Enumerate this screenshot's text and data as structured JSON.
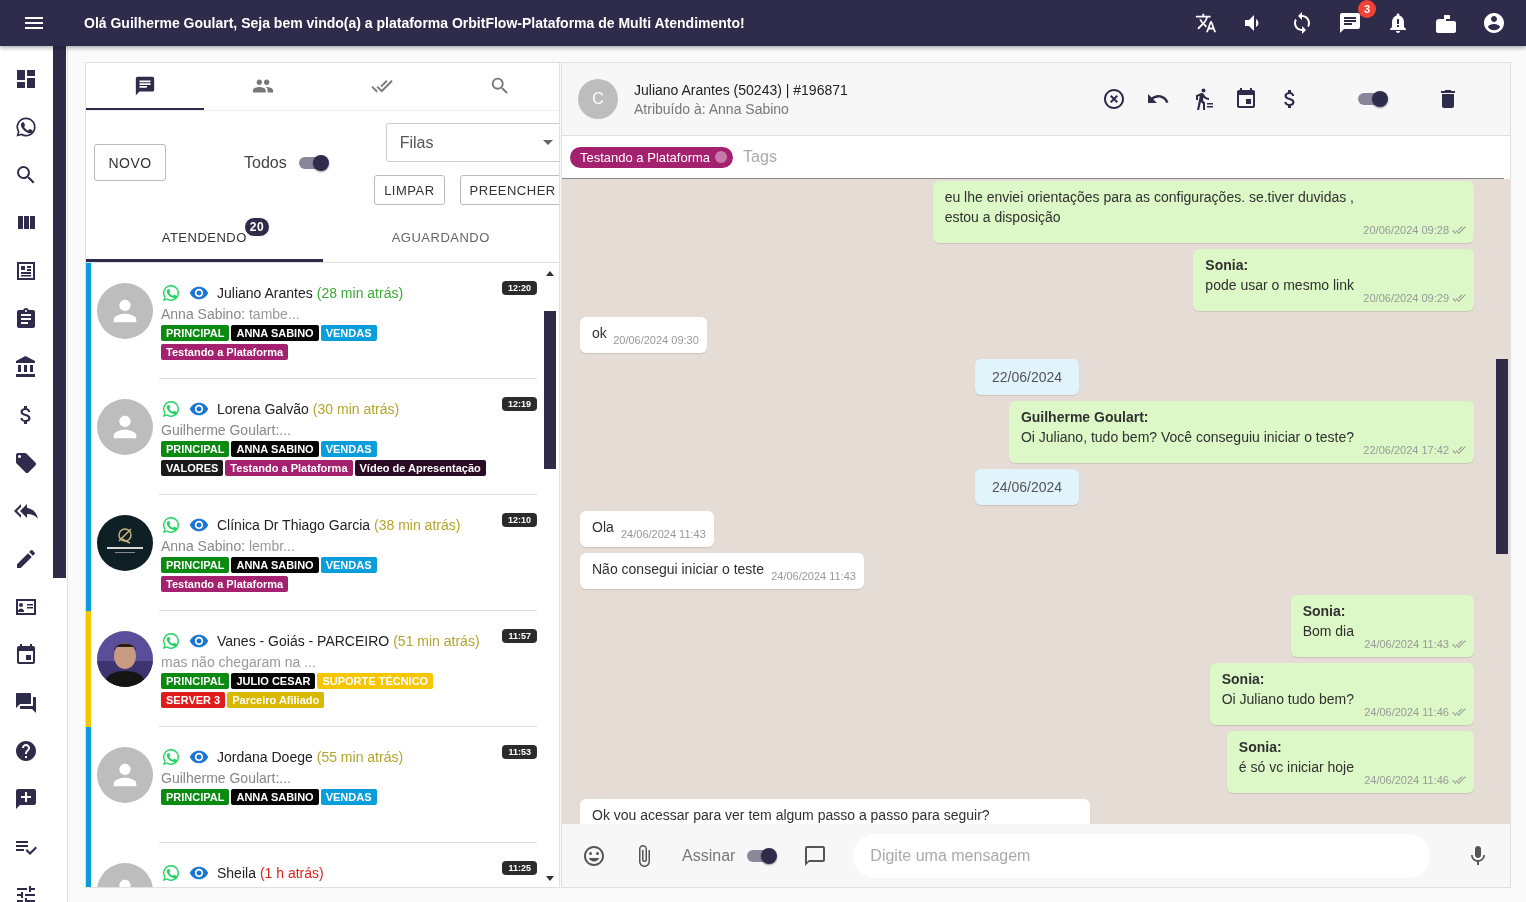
{
  "top_bar": {
    "title": "Olá Guilherme Goulart, Seja bem vindo(a) a plataforma OrbitFlow-Plataforma de Multi Atendimento!",
    "chat_badge": "3"
  },
  "ticket_panel": {
    "tabs": [
      {
        "selected": true
      },
      {
        "selected": false
      },
      {
        "selected": false
      },
      {
        "selected": false
      }
    ],
    "new_button": "NOVO",
    "all_toggle": {
      "label": "Todos",
      "on": true
    },
    "queue_select": {
      "placeholder": "Filas"
    },
    "clear_button": "LIMPAR",
    "fill_button": "PREENCHER",
    "subtabs": [
      {
        "label": "ATENDENDO",
        "badge": "20",
        "selected": true
      },
      {
        "label": "AGUARDANDO",
        "selected": false
      }
    ],
    "tickets": [
      {
        "name": "Juliano Arantes",
        "ago": {
          "text": "(28 min atrás)",
          "color": "#3aaa35"
        },
        "color": "#0a9ddc",
        "avatar": {
          "kind": "default"
        },
        "time": "12:20",
        "preview_author": "Anna Sabino:",
        "preview": "tambe...",
        "badges": [
          {
            "label": "PRINCIPAL",
            "color": "#0b8a12"
          },
          {
            "label": "ANNA SABINO",
            "color": "#050505"
          },
          {
            "label": "VENDAS",
            "color": "#0a9ddc"
          }
        ],
        "tags": [
          {
            "label": "Testando a Plataforma",
            "color": "#a3216f"
          }
        ]
      },
      {
        "name": "Lorena Galvão",
        "ago": {
          "text": "(30 min atrás)",
          "color": "#b3a52a"
        },
        "color": "#0a9ddc",
        "avatar": {
          "kind": "default"
        },
        "time": "12:19",
        "preview_author": "Guilherme Goulart:...",
        "badges": [
          {
            "label": "PRINCIPAL",
            "color": "#0b8a12"
          },
          {
            "label": "ANNA SABINO",
            "color": "#050505"
          },
          {
            "label": "VENDAS",
            "color": "#0a9ddc"
          }
        ],
        "tags": [
          {
            "label": "VALORES",
            "color": "#1a1a1a"
          },
          {
            "label": "Testando a Plataforma",
            "color": "#a3216f"
          },
          {
            "label": "Vídeo de Apresentação",
            "color": "#2b0a24"
          }
        ]
      },
      {
        "name": "Clínica Dr Thiago Garcia",
        "ago": {
          "text": "(38 min atrás)",
          "color": "#b3a52a"
        },
        "color": "#0a9ddc",
        "avatar": {
          "kind": "logo"
        },
        "time": "12:10",
        "preview_author": "Anna Sabino:",
        "preview": "lembr...",
        "badges": [
          {
            "label": "PRINCIPAL",
            "color": "#0b8a12"
          },
          {
            "label": "ANNA SABINO",
            "color": "#050505"
          },
          {
            "label": "VENDAS",
            "color": "#0a9ddc"
          }
        ],
        "tags": [
          {
            "label": "Testando a Plataforma",
            "color": "#a3216f"
          }
        ]
      },
      {
        "name": "Vanes - Goiás - PARCEIRO",
        "ago": {
          "text": "(51 min atrás)",
          "color": "#b3a52a"
        },
        "color": "#f7c600",
        "avatar": {
          "kind": "picture"
        },
        "time": "11:57",
        "preview": "mas não chegaram na ...",
        "badges": [
          {
            "label": "PRINCIPAL",
            "color": "#0b8a12"
          },
          {
            "label": "JULIO CESAR",
            "color": "#050505"
          },
          {
            "label": "SUPORTE TÉCNICO",
            "color": "#f7c600"
          }
        ],
        "tags": [
          {
            "label": "SERVER 3",
            "color": "#e01b1b"
          },
          {
            "label": "Parceiro Afiliado",
            "color": "#d8b800"
          }
        ]
      },
      {
        "name": "Jordana Doege",
        "ago": {
          "text": "(55 min atrás)",
          "color": "#b3a52a"
        },
        "color": "#0a9ddc",
        "avatar": {
          "kind": "default"
        },
        "time": "11:53",
        "preview_author": "Guilherme Goulart:...",
        "badges": [
          {
            "label": "PRINCIPAL",
            "color": "#0b8a12"
          },
          {
            "label": "ANNA SABINO",
            "color": "#050505"
          },
          {
            "label": "VENDAS",
            "color": "#0a9ddc"
          }
        ]
      },
      {
        "name": "Sheila",
        "ago": {
          "text": "(1 h atrás)",
          "color": "#e0201c"
        },
        "color": "#0a9ddc",
        "avatar": {
          "kind": "default"
        },
        "time": "11:25"
      }
    ]
  },
  "chat": {
    "avatar_letter": "C",
    "title": "Juliano Arantes (50243) | #196871",
    "subtitle": "Atribuído à: Anna Sabino",
    "action_toggle": {
      "on": true
    },
    "tag_chips": [
      "Testando a Plataforma"
    ],
    "tags_placeholder": "Tags",
    "messages": [
      {
        "kind": "out",
        "text": "eu lhe enviei orientações para as configurações.  se.tiver duvidas ,\nestou a disposição",
        "time": "20/06/2024 09:28"
      },
      {
        "kind": "out",
        "sender": "Sonia:",
        "text": "pode usar o mesmo link",
        "time": "20/06/2024 09:29"
      },
      {
        "kind": "in",
        "text": "ok",
        "time": "20/06/2024 09:30"
      },
      {
        "kind": "date",
        "text": "22/06/2024"
      },
      {
        "kind": "out",
        "sender": "Guilherme Goulart:",
        "text": "Oi Juliano, tudo bem? Você conseguiu iniciar o teste?",
        "time": "22/06/2024 17:42"
      },
      {
        "kind": "date",
        "text": "24/06/2024"
      },
      {
        "kind": "in",
        "text": "Ola",
        "time": "24/06/2024 11:43"
      },
      {
        "kind": "in",
        "text": "Não consegui iniciar o teste",
        "time": "24/06/2024 11:43"
      },
      {
        "kind": "out",
        "sender": "Sonia:",
        "text": "Bom dia",
        "time": "24/06/2024 11:43"
      },
      {
        "kind": "out",
        "sender": "Sonia:",
        "text": "Oi Juliano tudo bem?",
        "time": "24/06/2024 11:46"
      },
      {
        "kind": "out",
        "sender": "Sonia:",
        "text": "é só vc iniciar hoje",
        "time": "24/06/2024 11:46"
      },
      {
        "kind": "in",
        "text": "Ok vou acessar para ver tem algum passo a passo para seguir?"
      }
    ],
    "composer": {
      "sign_toggle": {
        "label": "Assinar",
        "on": true
      },
      "placeholder": "Digite uma mensagem"
    }
  }
}
